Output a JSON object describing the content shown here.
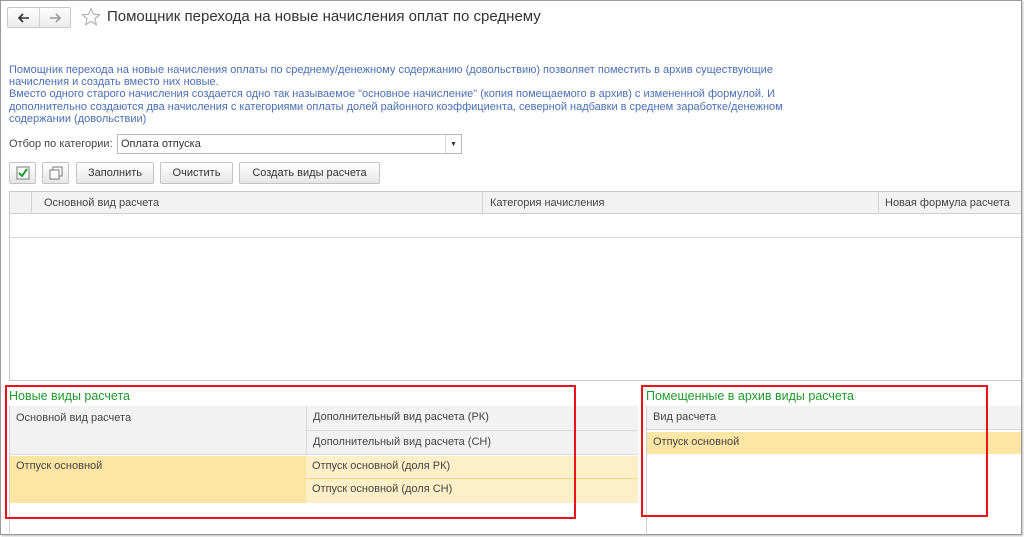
{
  "window": {
    "title": "Помощник перехода на новые начисления оплат по среднему"
  },
  "description": {
    "line1": "Помощник перехода на новые начисления оплаты по среднему/денежному содержанию (довольствию) позволяет поместить в архив существующие",
    "line2": "начисления и создать вместо них новые.",
    "line3": "Вместо одного старого начисления создается одно так называемое \"основное начисление\" (копия помещаемого в архив) с измененной формулой. И",
    "line4": "дополнительно создаются два начисления с категориями оплаты долей районного коэффициента, северной надбавки в среднем заработке/денежном",
    "line5": "содержании (довольствии)"
  },
  "filter": {
    "label": "Отбор по категории:",
    "value": "Оплата отпуска"
  },
  "toolbar": {
    "fill_label": "Заполнить",
    "clear_label": "Очистить",
    "create_label": "Создать виды расчета"
  },
  "main_table": {
    "columns": [
      "Основной вид расчета",
      "Категория начисления",
      "Новая формула расчета"
    ]
  },
  "new_types": {
    "title": "Новые виды расчета",
    "col_main": "Основной вид расчета",
    "col_extra_rk": "Дополнительный вид расчета (РК)",
    "col_extra_sn": "Дополнительный вид расчета (СН)",
    "row": {
      "main": "Отпуск основной",
      "extra_rk": "Отпуск основной (доля РК)",
      "extra_sn": "Отпуск основной (доля СН)"
    }
  },
  "archived": {
    "title": "Помещенные в архив виды расчета",
    "col": "Вид расчета",
    "row": "Отпуск основной"
  },
  "colors": {
    "section_title": "#1f9a2c",
    "description": "#4a6fb5",
    "selection": "#fde6a3",
    "highlight_box": "#e8141a"
  }
}
